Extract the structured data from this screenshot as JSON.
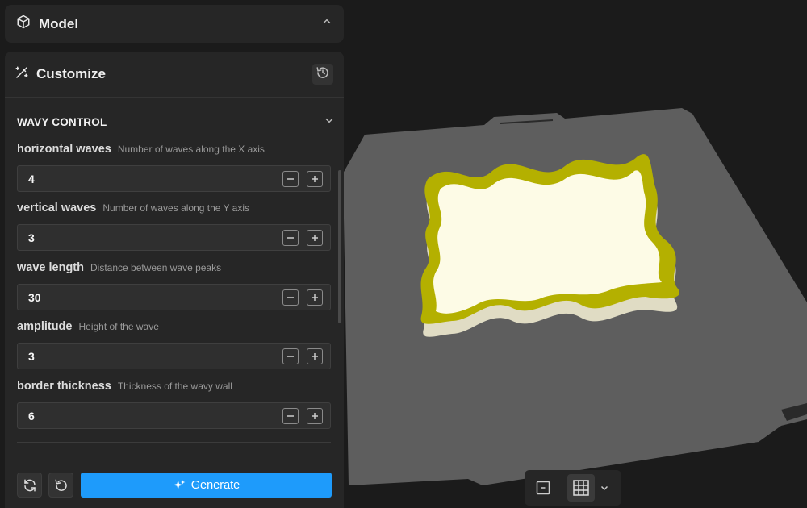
{
  "model_panel": {
    "title": "Model",
    "icon": "cube-icon"
  },
  "customize_panel": {
    "title": "Customize",
    "icon": "magic-wand-icon",
    "history_icon": "history-icon"
  },
  "section": {
    "label": "WAVY CONTROL"
  },
  "params": [
    {
      "name": "horizontal waves",
      "desc": "Number of waves along the X axis",
      "value": "4"
    },
    {
      "name": "vertical waves",
      "desc": "Number of waves along the Y axis",
      "value": "3"
    },
    {
      "name": "wave length",
      "desc": "Distance between wave peaks",
      "value": "30"
    },
    {
      "name": "amplitude",
      "desc": "Height of the wave",
      "value": "3"
    },
    {
      "name": "border thickness",
      "desc": "Thickness of the wavy wall",
      "value": "6"
    }
  ],
  "footer": {
    "generate_label": "Generate"
  },
  "colors": {
    "accent": "#1e9bfb",
    "model_wall": "#b4b000",
    "model_base": "#fdfbe6",
    "build_plate": "#5e5e5e"
  }
}
